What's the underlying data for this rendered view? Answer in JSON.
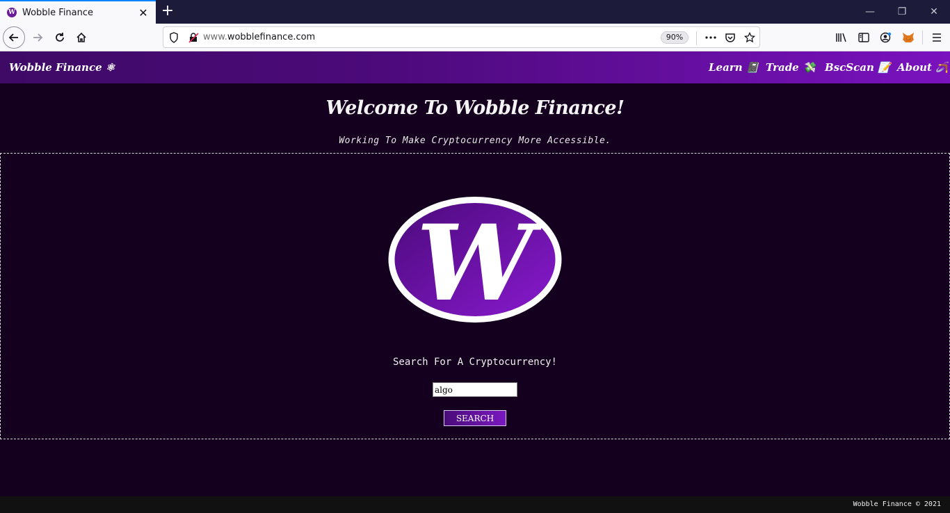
{
  "browser": {
    "tab_title": "Wobble Finance",
    "tab_favicon_letter": "W",
    "url_prefix": "www.",
    "url_domain": "wobblefinance.com",
    "zoom": "90%"
  },
  "site": {
    "brand": "Wobble Finance ⚛",
    "nav": [
      {
        "label": "Learn 📓"
      },
      {
        "label": "Trade 💸"
      },
      {
        "label": "BscScan 📝"
      },
      {
        "label": "About 🪃"
      }
    ],
    "hero_title": "Welcome To Wobble Finance!",
    "hero_subtitle": "Working To Make Cryptocurrency More Accessible.",
    "logo_letter": "W",
    "search_label": "Search For A Cryptocurrency!",
    "search_value": "algo",
    "search_button": "SEARCH",
    "footer": "Wobble Finance © 2021"
  },
  "colors": {
    "page_bg": "#14001e",
    "nav_gradient_start": "#3e0a66",
    "nav_gradient_end": "#7a12bf",
    "logo_fill_start": "#4a0a7a",
    "logo_fill_end": "#8a1ad0"
  }
}
